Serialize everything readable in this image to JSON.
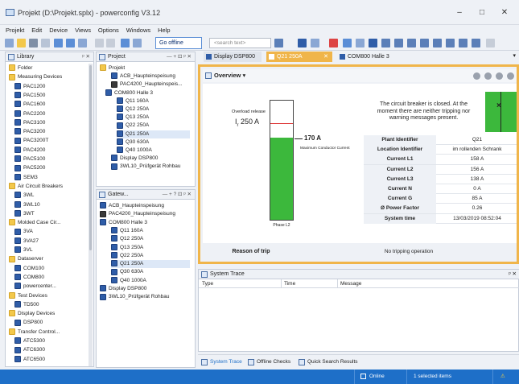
{
  "window": {
    "title": "Projekt (D:\\Projekt.splx) - powerconfig V3.12"
  },
  "menu": [
    "Projekt",
    "Edit",
    "Device",
    "Views",
    "Options",
    "Windows",
    "Help"
  ],
  "toolbar": {
    "go_offline": "Go offline",
    "search_placeholder": "<search text>"
  },
  "library": {
    "title": "Library",
    "items": [
      {
        "label": "Folder",
        "type": "folder",
        "indent": 0
      },
      {
        "label": "Measuring Devices",
        "type": "folder",
        "indent": 0
      },
      {
        "label": "PAC1200",
        "type": "dev",
        "indent": 1
      },
      {
        "label": "PAC1500",
        "type": "dev",
        "indent": 1
      },
      {
        "label": "PAC1600",
        "type": "dev",
        "indent": 1
      },
      {
        "label": "PAC2200",
        "type": "dev",
        "indent": 1
      },
      {
        "label": "PAC3100",
        "type": "dev",
        "indent": 1
      },
      {
        "label": "PAC3200",
        "type": "dev",
        "indent": 1
      },
      {
        "label": "PAC3200T",
        "type": "dev",
        "indent": 1
      },
      {
        "label": "PAC4200",
        "type": "dev",
        "indent": 1
      },
      {
        "label": "PAC5100",
        "type": "dev",
        "indent": 1
      },
      {
        "label": "PAC5200",
        "type": "dev",
        "indent": 1
      },
      {
        "label": "SEM3",
        "type": "dev",
        "indent": 1
      },
      {
        "label": "Air Circuit Breakers",
        "type": "folder",
        "indent": 0
      },
      {
        "label": "3WL",
        "type": "dev",
        "indent": 1
      },
      {
        "label": "3WL10",
        "type": "dev",
        "indent": 1
      },
      {
        "label": "3WT",
        "type": "dev",
        "indent": 1
      },
      {
        "label": "Molded Case Cir...",
        "type": "folder",
        "indent": 0
      },
      {
        "label": "3VA",
        "type": "dev",
        "indent": 1
      },
      {
        "label": "3VA27",
        "type": "dev",
        "indent": 1
      },
      {
        "label": "3VL",
        "type": "dev",
        "indent": 1
      },
      {
        "label": "Dataserver",
        "type": "folder",
        "indent": 0
      },
      {
        "label": "COM100",
        "type": "dev",
        "indent": 1
      },
      {
        "label": "COM800",
        "type": "dev",
        "indent": 1
      },
      {
        "label": "powercenter...",
        "type": "dev",
        "indent": 1
      },
      {
        "label": "Test Devices",
        "type": "folder",
        "indent": 0
      },
      {
        "label": "TD500",
        "type": "dev",
        "indent": 1
      },
      {
        "label": "Display Devices",
        "type": "folder",
        "indent": 0
      },
      {
        "label": "DSP800",
        "type": "dev",
        "indent": 1
      },
      {
        "label": "Transfer Control...",
        "type": "folder",
        "indent": 0
      },
      {
        "label": "ATC5300",
        "type": "dev",
        "indent": 1
      },
      {
        "label": "ATC6300",
        "type": "dev",
        "indent": 1
      },
      {
        "label": "ATC6500",
        "type": "dev",
        "indent": 1
      }
    ]
  },
  "project": {
    "title": "Project",
    "items": [
      {
        "label": "Projekt",
        "type": "folder",
        "indent": 0
      },
      {
        "label": "ACB_Haupteinspeisung",
        "type": "dev",
        "indent": 2
      },
      {
        "label": "PAC4200_Haupteinspeis...",
        "type": "devg",
        "indent": 2
      },
      {
        "label": "COM800 Halle 3",
        "type": "dev",
        "indent": 1
      },
      {
        "label": "Q11 160A",
        "type": "dev",
        "indent": 3
      },
      {
        "label": "Q12 250A",
        "type": "dev",
        "indent": 3
      },
      {
        "label": "Q13 250A",
        "type": "dev",
        "indent": 3
      },
      {
        "label": "Q22 250A",
        "type": "dev",
        "indent": 3
      },
      {
        "label": "Q21 250A",
        "type": "dev",
        "indent": 3,
        "selected": true
      },
      {
        "label": "Q30 630A",
        "type": "dev",
        "indent": 3
      },
      {
        "label": "Q40 1000A",
        "type": "dev",
        "indent": 3
      },
      {
        "label": "Display DSP800",
        "type": "dev",
        "indent": 2
      },
      {
        "label": "3WL10_Prüfgerät Rohbau",
        "type": "dev",
        "indent": 2
      }
    ]
  },
  "gateway": {
    "title": "Gatew...",
    "items": [
      {
        "label": "ACB_Haupteinspeisung",
        "type": "dev",
        "indent": 0
      },
      {
        "label": "PAC4200_Haupteinspeisung",
        "type": "devg",
        "indent": 0
      },
      {
        "label": "COM800 Halle 3",
        "type": "dev",
        "indent": 0
      },
      {
        "label": "Q11 160A",
        "type": "dev",
        "indent": 2
      },
      {
        "label": "Q12 250A",
        "type": "dev",
        "indent": 2
      },
      {
        "label": "Q13 250A",
        "type": "dev",
        "indent": 2
      },
      {
        "label": "Q22 250A",
        "type": "dev",
        "indent": 2
      },
      {
        "label": "Q21 250A",
        "type": "dev",
        "indent": 2,
        "selected": true
      },
      {
        "label": "Q30 630A",
        "type": "dev",
        "indent": 2
      },
      {
        "label": "Q40 1000A",
        "type": "dev",
        "indent": 2
      },
      {
        "label": "Display DSP800",
        "type": "dev",
        "indent": 0
      },
      {
        "label": "3WL10_Prüfgerät Rohbau",
        "type": "dev",
        "indent": 0
      }
    ]
  },
  "tabs": [
    "Display DSP800",
    "Q21 250A",
    "COM800 Halle 3"
  ],
  "overview": {
    "title": "Overview",
    "overload_label": "Overload release",
    "ir_symbol": "I",
    "ir_sub": "r",
    "ir_value": "250 A",
    "current_value": "170 A",
    "max_label": "Maximum Conductor Current",
    "phase_label": "Phase L2",
    "status_message": "The circuit breaker is closed. At the moment there are neither tripping nor warning messages present.",
    "kv": [
      {
        "key": "Plant Identifier",
        "value": "Q21"
      },
      {
        "key": "Location Identifier",
        "value": "im rollenden Schrank"
      },
      {
        "key": "Current L1",
        "value": "158 A"
      },
      {
        "key": "Current L2",
        "value": "156 A"
      },
      {
        "key": "Current L3",
        "value": "138 A"
      },
      {
        "key": "Current N",
        "value": "0 A"
      },
      {
        "key": "Current G",
        "value": "85 A"
      },
      {
        "key": "Ø Power Factor",
        "value": "0.26"
      },
      {
        "key": "System time",
        "value": "13/03/2019 08:52:04"
      }
    ],
    "reason_label": "Reason of trip",
    "reason_value": "No tripping operation",
    "current_fraction": 0.68
  },
  "trace": {
    "title": "System Trace",
    "cols": [
      "Type",
      "Time",
      "Message"
    ]
  },
  "bottom_tabs": [
    "System Trace",
    "Offline Checks",
    "Quick Search Results"
  ],
  "status": {
    "online": "Online",
    "selected": "1 selected items"
  },
  "colors": {
    "accent": "#f0b54a",
    "bar_green": "#3cb83c",
    "status_blue": "#1e6fc8"
  }
}
